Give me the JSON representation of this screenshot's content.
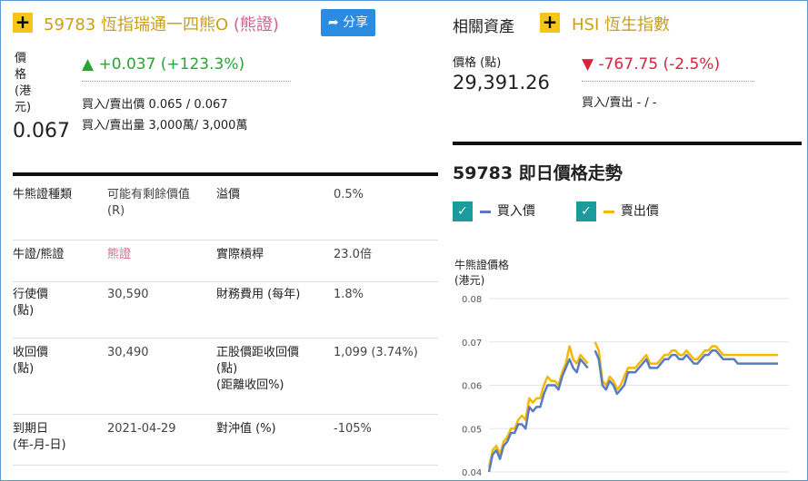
{
  "warrant": {
    "code_name": "59783 恆指瑞通一四熊O",
    "type_tag": "(熊證)",
    "share_label": "分享",
    "price_label_chars": [
      "價",
      "格",
      "(港",
      "元)"
    ],
    "price": "0.067",
    "change": "+0.037 (+123.3%)",
    "bid_ask_price": "買入/賣出價 0.065 / 0.067",
    "bid_ask_volume": "買入/賣出量 3,000萬/ 3,000萬"
  },
  "asset": {
    "section_label": "相關資產",
    "index_name": "HSI 恆生指數",
    "price_label": "價格 (點)",
    "price": "29,391.26",
    "change": "-767.75 (-2.5%)",
    "bid_ask": "買入/賣出 - / -"
  },
  "details": [
    {
      "l1": "牛熊證種類",
      "v1": "可能有剩餘價值\n(R)",
      "l2": "溢價",
      "v2": "0.5%"
    },
    {
      "l1": "牛證/熊證",
      "v1": "熊證",
      "l2": "實際槓桿",
      "v2": "23.0倍"
    },
    {
      "l1": "行使價\n(點)",
      "v1": "30,590",
      "l2": "財務費用 (每年)",
      "v2": "1.8%"
    },
    {
      "l1": "收回價\n(點)",
      "v1": "30,490",
      "l2": "正股價距收回價\n(點)\n(距離收回%)",
      "v2": "1,099 (3.74%)"
    },
    {
      "l1": "到期日\n(年-月-日)",
      "v1": "2021-04-29",
      "l2": "對沖值 (%)",
      "v2": "-105%"
    }
  ],
  "chart": {
    "title": "59783 即日價格走勢",
    "legend_bid": "買入價",
    "legend_ask": "賣出價",
    "ylabel_line1": "牛熊證價格",
    "ylabel_line2": "(港元)",
    "colors": {
      "bid": "#5a7bbf",
      "ask": "#f5b800",
      "check": "#1b9b9b"
    }
  },
  "chart_data": {
    "type": "line",
    "yticks": [
      0.08,
      0.07,
      0.06,
      0.05,
      0.04
    ],
    "ylim": [
      0.04,
      0.08
    ],
    "x": [
      0,
      1,
      2,
      3,
      4,
      5,
      6,
      7,
      8,
      9,
      10,
      11,
      12,
      13,
      14,
      15,
      16,
      17,
      18,
      19,
      20,
      21,
      22,
      23,
      24,
      25,
      26,
      27,
      28,
      29,
      30,
      31,
      32,
      33,
      34,
      35,
      36,
      37,
      38,
      39,
      40,
      41,
      42,
      43,
      44,
      45,
      46,
      47,
      48,
      49,
      50,
      51,
      52,
      53,
      54,
      55,
      56,
      57,
      58,
      59,
      60,
      61,
      62,
      63,
      64,
      65,
      66,
      67,
      68,
      69,
      70,
      71,
      72,
      73,
      74,
      75,
      76,
      77,
      78,
      79
    ],
    "series": [
      {
        "name": "買入價",
        "values": [
          0.04,
          0.044,
          0.045,
          0.043,
          0.046,
          0.047,
          0.049,
          0.049,
          0.051,
          0.051,
          0.05,
          0.055,
          0.054,
          0.055,
          0.055,
          0.058,
          0.06,
          0.06,
          0.06,
          0.059,
          0.062,
          0.064,
          0.066,
          0.064,
          0.063,
          0.066,
          0.065,
          0.064,
          null,
          0.068,
          0.066,
          0.06,
          0.059,
          0.061,
          0.06,
          0.058,
          0.059,
          0.06,
          0.063,
          0.063,
          0.063,
          0.064,
          0.065,
          0.066,
          0.064,
          0.064,
          0.064,
          0.065,
          0.066,
          0.066,
          0.067,
          0.067,
          0.066,
          0.066,
          0.067,
          0.066,
          0.065,
          0.065,
          0.066,
          0.067,
          0.067,
          0.068,
          0.068,
          0.067,
          0.066,
          0.066,
          0.066,
          0.066,
          0.065,
          0.065,
          0.065,
          0.065,
          0.065,
          0.065,
          0.065,
          0.065,
          0.065,
          0.065,
          0.065,
          0.065
        ]
      },
      {
        "name": "賣出價",
        "values": [
          0.041,
          0.045,
          0.046,
          0.044,
          0.047,
          0.048,
          0.05,
          0.05,
          0.052,
          0.053,
          0.052,
          0.057,
          0.056,
          0.057,
          0.057,
          0.06,
          0.062,
          0.061,
          0.061,
          0.06,
          0.063,
          0.065,
          0.069,
          0.066,
          0.065,
          0.067,
          0.066,
          0.065,
          null,
          0.07,
          0.068,
          0.061,
          0.06,
          0.062,
          0.061,
          0.059,
          0.06,
          0.062,
          0.064,
          0.064,
          0.064,
          0.065,
          0.066,
          0.067,
          0.065,
          0.065,
          0.065,
          0.066,
          0.067,
          0.067,
          0.068,
          0.068,
          0.067,
          0.067,
          0.068,
          0.067,
          0.066,
          0.066,
          0.067,
          0.068,
          0.068,
          0.069,
          0.069,
          0.068,
          0.067,
          0.067,
          0.067,
          0.067,
          0.067,
          0.067,
          0.067,
          0.067,
          0.067,
          0.067,
          0.067,
          0.067,
          0.067,
          0.067,
          0.067,
          0.067
        ]
      }
    ]
  }
}
